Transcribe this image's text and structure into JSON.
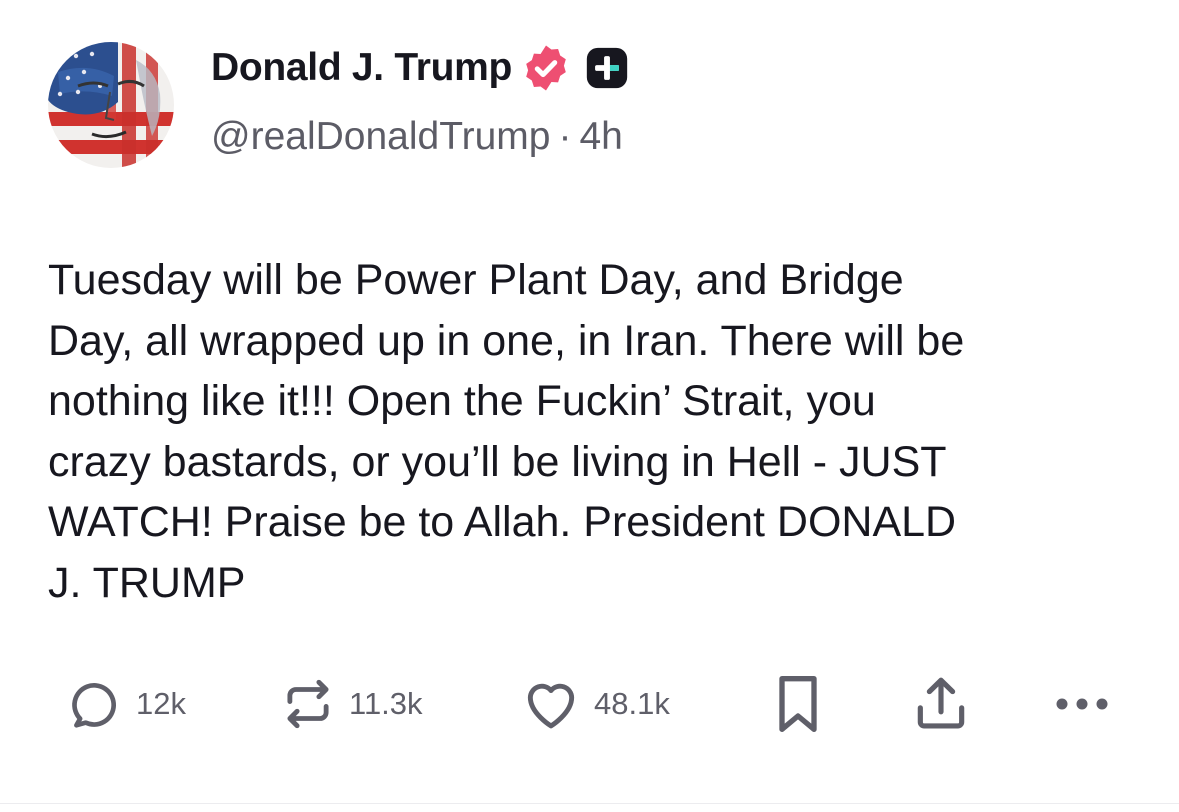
{
  "author": {
    "display_name": "Donald J. Trump",
    "handle": "@realDonaldTrump",
    "separator": "·",
    "time_ago": "4h"
  },
  "post": {
    "text": "Tuesday will be Power Plant Day, and Bridge\nDay, all wrapped up in one, in Iran. There will be\nnothing like it!!! Open the Fuckin’ Strait, you\ncrazy bastards, or you’ll be living in Hell - JUST\nWATCH! Praise be to Allah. President DONALD\nJ. TRUMP"
  },
  "actions": {
    "replies": "12k",
    "reposts": "11.3k",
    "likes": "48.1k"
  },
  "icons": {
    "verified": "verified-badge-icon",
    "plus_badge": "plus-badge-icon",
    "reply": "reply-bubble-icon",
    "repost": "repost-icon",
    "like": "heart-icon",
    "bookmark": "bookmark-icon",
    "share": "share-icon",
    "more": "more-icon"
  },
  "colors": {
    "verified_badge": "#ee4f72",
    "text_primary": "#17171f",
    "text_secondary": "#5c5c66",
    "icon": "#5f5f69"
  }
}
